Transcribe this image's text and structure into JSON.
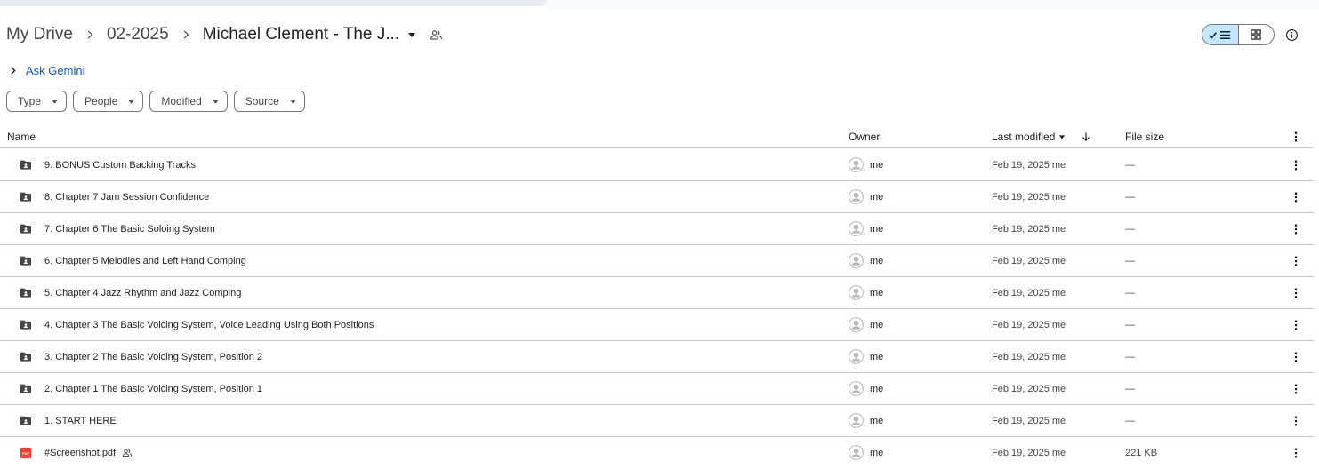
{
  "breadcrumb": {
    "items": [
      "My Drive",
      "02-2025",
      "Michael Clement - The J..."
    ]
  },
  "gemini": {
    "label": "Ask Gemini"
  },
  "filters": [
    "Type",
    "People",
    "Modified",
    "Source"
  ],
  "table": {
    "headers": {
      "name": "Name",
      "owner": "Owner",
      "modified": "Last modified",
      "size": "File size"
    },
    "rows": [
      {
        "name": "9. BONUS Custom Backing Tracks",
        "owner": "me",
        "modified": "Feb 19, 2025 me",
        "size": "—",
        "type": "folder-shared"
      },
      {
        "name": "8. Chapter 7 Jam Session Confidence",
        "owner": "me",
        "modified": "Feb 19, 2025 me",
        "size": "—",
        "type": "folder-shared"
      },
      {
        "name": "7. Chapter 6 The Basic Soloing System",
        "owner": "me",
        "modified": "Feb 19, 2025 me",
        "size": "—",
        "type": "folder-shared"
      },
      {
        "name": "6. Chapter 5 Melodies and Left Hand Comping",
        "owner": "me",
        "modified": "Feb 19, 2025 me",
        "size": "—",
        "type": "folder-shared"
      },
      {
        "name": "5. Chapter 4 Jazz Rhythm and Jazz Comping",
        "owner": "me",
        "modified": "Feb 19, 2025 me",
        "size": "—",
        "type": "folder-shared"
      },
      {
        "name": "4. Chapter 3 The Basic Voicing System, Voice Leading Using Both Positions",
        "owner": "me",
        "modified": "Feb 19, 2025 me",
        "size": "—",
        "type": "folder-shared"
      },
      {
        "name": "3. Chapter 2 The Basic Voicing System, Position 2",
        "owner": "me",
        "modified": "Feb 19, 2025 me",
        "size": "—",
        "type": "folder-shared"
      },
      {
        "name": "2. Chapter 1 The Basic Voicing System, Position 1",
        "owner": "me",
        "modified": "Feb 19, 2025 me",
        "size": "—",
        "type": "folder-shared"
      },
      {
        "name": "1. START HERE",
        "owner": "me",
        "modified": "Feb 19, 2025 me",
        "size": "—",
        "type": "folder-shared"
      },
      {
        "name": "#Screenshot.pdf",
        "owner": "me",
        "modified": "Feb 19, 2025 me",
        "size": "221 KB",
        "type": "pdf",
        "shared": true
      }
    ]
  },
  "icons": {
    "folder": "folder-shared-icon",
    "pdf": "pdf-icon",
    "pdf_label": "PDF"
  },
  "colors": {
    "accent": "#0b57d0",
    "toggle_active": "#c2e7ff",
    "pdf_red": "#ea4335"
  }
}
